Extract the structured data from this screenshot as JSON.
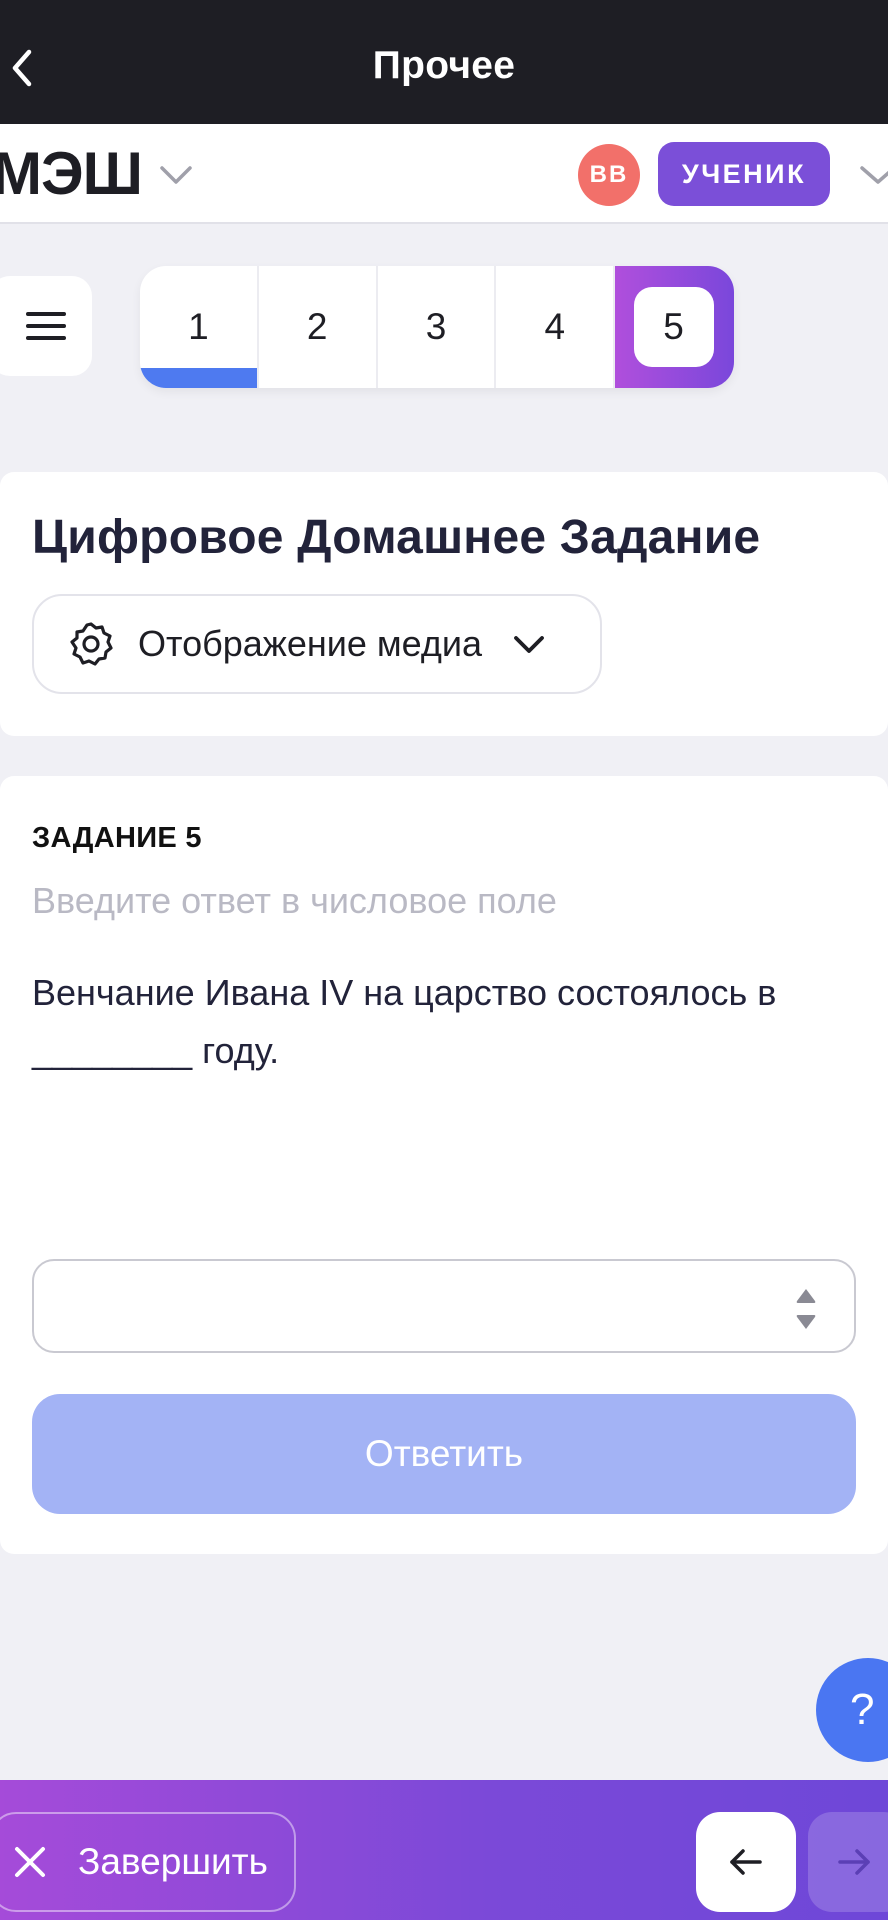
{
  "header": {
    "title": "Прочее",
    "back_icon": "chevron-left-icon"
  },
  "appbar": {
    "logo": "МЭШ",
    "avatar_initials": "ВВ",
    "role_label": "УЧЕНИК",
    "colors": {
      "avatar": "#f2706a",
      "role": "#7b4fd8"
    }
  },
  "menu_icon": "hamburger-icon",
  "steps": {
    "items": [
      {
        "label": "1",
        "state": "done"
      },
      {
        "label": "2",
        "state": "todo"
      },
      {
        "label": "3",
        "state": "todo"
      },
      {
        "label": "4",
        "state": "todo"
      },
      {
        "label": "5",
        "state": "active"
      }
    ],
    "colors": {
      "done_underline": "#4e7af0",
      "active_from": "#b04fdc",
      "active_to": "#7a47db"
    }
  },
  "main": {
    "title": "Цифровое Домашнее Задание",
    "media_toggle_label": "Отображение медиа"
  },
  "task": {
    "label": "ЗАДАНИЕ 5",
    "hint": "Введите ответ в числовое поле",
    "question": "Венчание Ивана IV на царство состоялось в ________ году.",
    "answer_value": "",
    "submit_label": "Ответить",
    "colors": {
      "submit_bg": "#a3b3f5"
    }
  },
  "help": {
    "label": "?"
  },
  "footer": {
    "finish_label": "Завершить",
    "prev_icon": "arrow-left-icon",
    "next_icon": "arrow-right-icon"
  }
}
